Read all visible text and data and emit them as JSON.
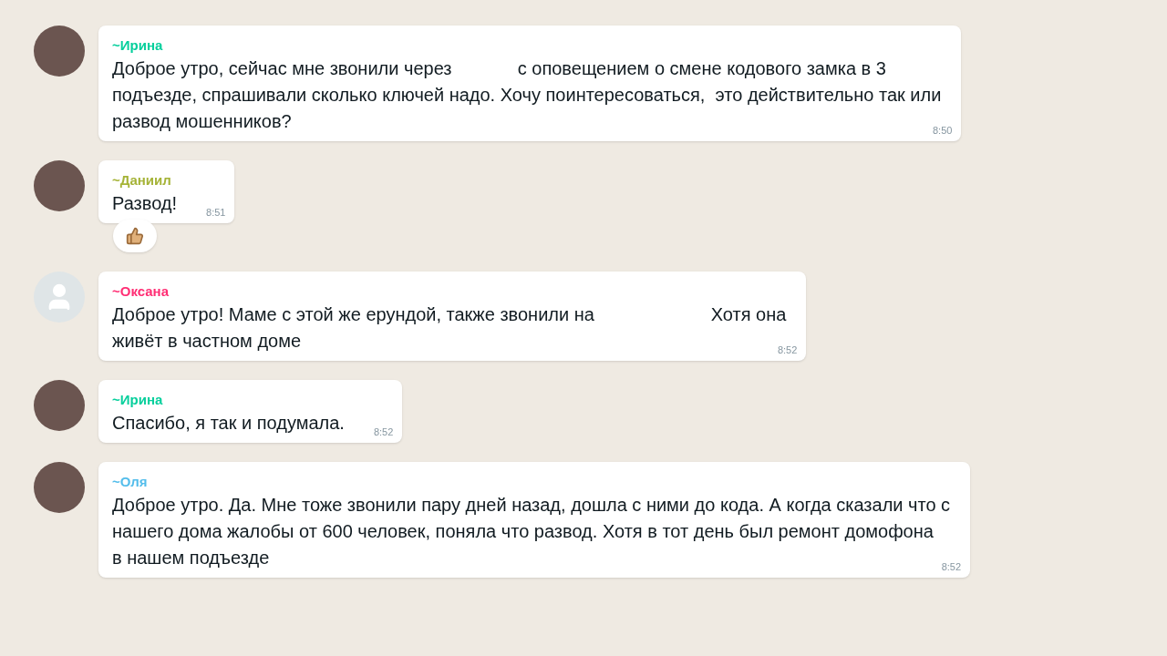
{
  "messages": [
    {
      "author": {
        "name": "~Ирина",
        "color": "#06cf9c"
      },
      "avatar": {
        "kind": "photo"
      },
      "lines": [
        "Доброе утро, сейчас мне звонили через             с оповещением о смене кодового замка в 3",
        "подъезде, спрашивали сколько ключей надо. Хочу поинтересоваться,  это действительно так или",
        "развод мошенников?"
      ],
      "time": "8:50"
    },
    {
      "author": {
        "name": "~Даниил",
        "color": "#a5b337"
      },
      "avatar": {
        "kind": "photo"
      },
      "lines": [
        "Развод!"
      ],
      "time": "8:51",
      "reaction": {
        "kind": "thumbs-up"
      }
    },
    {
      "author": {
        "name": "~Оксана",
        "color": "#ff2e74"
      },
      "avatar": {
        "kind": "default"
      },
      "lines": [
        "Доброе утро! Маме с этой же ерундой, также звонили на                       Хотя она",
        "живёт в частном доме"
      ],
      "time": "8:52"
    },
    {
      "author": {
        "name": "~Ирина",
        "color": "#06cf9c"
      },
      "avatar": {
        "kind": "photo"
      },
      "lines": [
        "Спасибо, я так и подумала."
      ],
      "time": "8:52"
    },
    {
      "author": {
        "name": "~Оля",
        "color": "#53bdeb"
      },
      "avatar": {
        "kind": "photo"
      },
      "lines": [
        "Доброе утро. Да. Мне тоже звонили пару дней назад, дошла с ними до кода. А когда сказали что с",
        "нашего дома жалобы от 600 человек, поняла что развод. Хотя в тот день был ремонт домофона",
        "в нашем подъезде"
      ],
      "time": "8:52"
    }
  ]
}
